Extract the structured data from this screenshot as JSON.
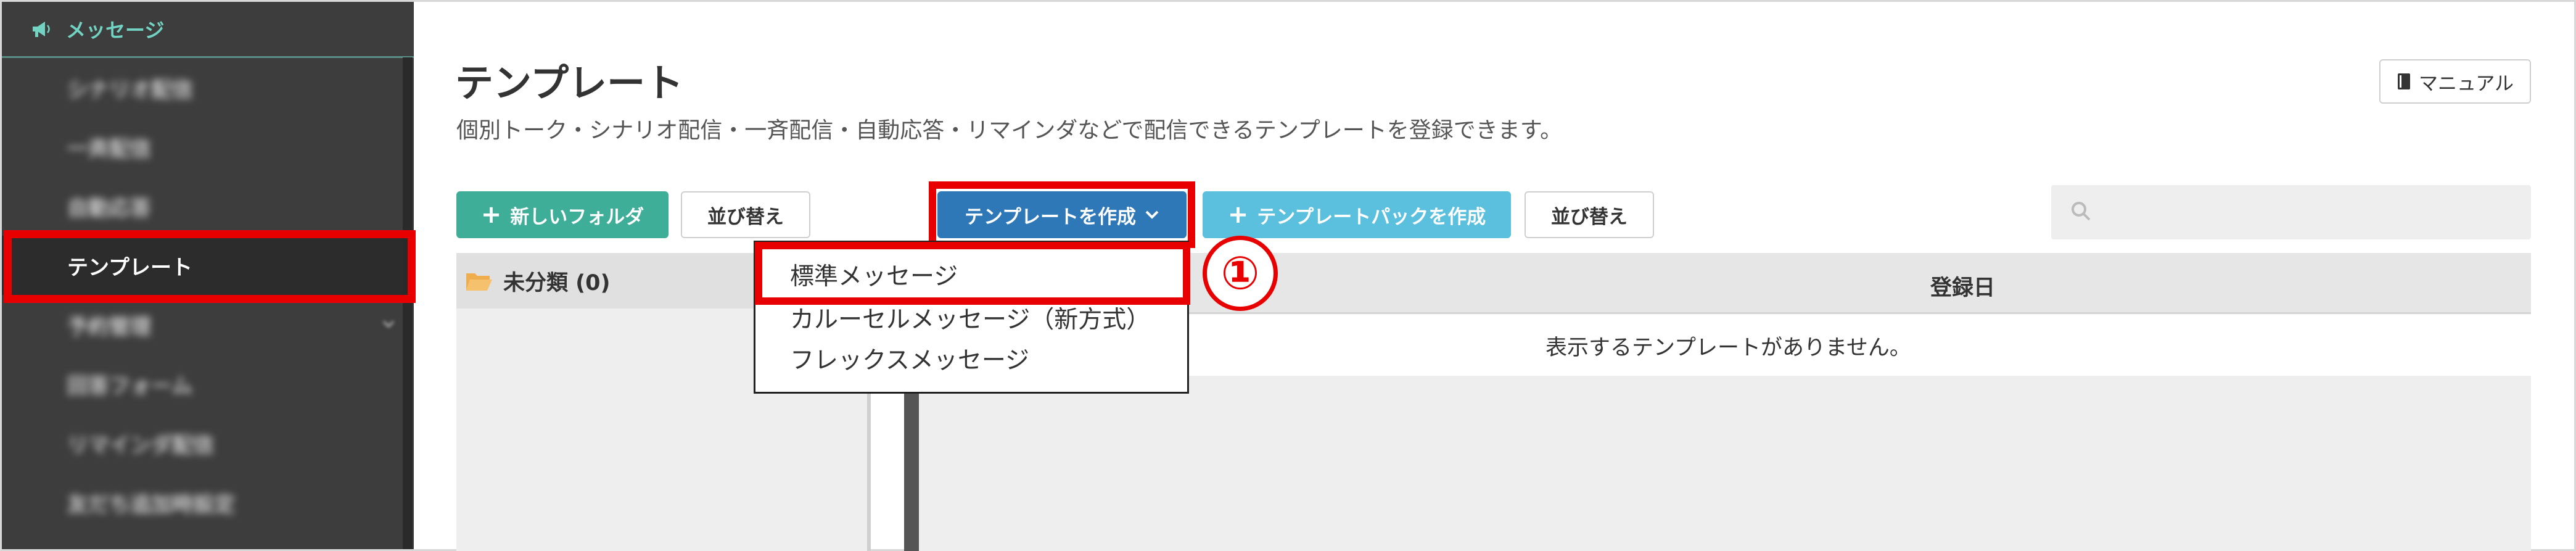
{
  "sidebar": {
    "header_label": "メッセージ",
    "header_icon": "megaphone-icon",
    "items": [
      {
        "label": "シナリオ配信",
        "blurred": true
      },
      {
        "label": "一斉配信",
        "blurred": true
      },
      {
        "label": "自動応答",
        "blurred": true
      },
      {
        "label": "テンプレート",
        "blurred": false,
        "active": true
      },
      {
        "label": "予約管理",
        "blurred": true
      },
      {
        "label": "回答フォーム",
        "blurred": true
      },
      {
        "label": "リマインダ配信",
        "blurred": true
      },
      {
        "label": "友だち追加時設定",
        "blurred": true
      }
    ]
  },
  "header": {
    "title": "テンプレート",
    "description": "個別トーク・シナリオ配信・一斉配信・自動応答・リマインダなどで配信できるテンプレートを登録できます。",
    "manual_label": "マニュアル"
  },
  "toolbar": {
    "new_folder_label": "新しいフォルダ",
    "sort_label_1": "並び替え",
    "create_template_label": "テンプレートを作成",
    "create_pack_label": "テンプレートパックを作成",
    "sort_label_2": "並び替え",
    "search_placeholder": ""
  },
  "folders": [
    {
      "label": "未分類 (0)"
    }
  ],
  "table": {
    "column_registered": "登録日",
    "empty_message": "表示するテンプレートがありません。"
  },
  "dropdown": {
    "items": [
      "標準メッセージ",
      "カルーセルメッセージ（新方式）",
      "フレックスメッセージ"
    ]
  },
  "annotation": {
    "step": "①"
  },
  "colors": {
    "sidebar_bg": "#3d3d3d",
    "accent_teal": "#3fae99",
    "primary_blue": "#2f78b8",
    "info_blue": "#5bc0de",
    "highlight_red": "#e80000"
  }
}
